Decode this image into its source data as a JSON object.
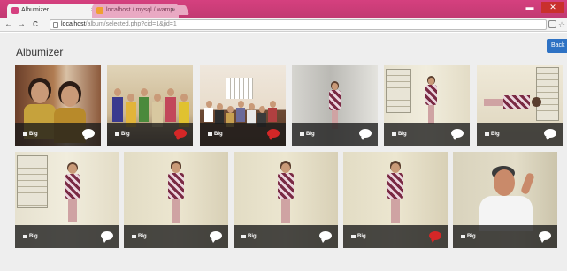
{
  "browser": {
    "tabs": [
      {
        "label": "Albumizer",
        "active": true,
        "favicon_color": "#d5407f"
      },
      {
        "label": "localhost / mysql / wampe",
        "active": false,
        "favicon_color": "#f0a030"
      }
    ],
    "close_glyph": "×",
    "url_host": "localhost",
    "url_path": "/album/selected.php?cid=1&jid=1",
    "nav": {
      "back": "←",
      "forward": "→",
      "reload": "C"
    },
    "window": {
      "minimize": "▬",
      "close": "✕"
    },
    "toolbar_icons": [
      "share-icon",
      "star-icon",
      "menu-icon"
    ]
  },
  "page": {
    "title": "Albumizer",
    "back_button": "Back"
  },
  "gallery": {
    "rows": [
      [
        {
          "label": "Big",
          "comment": "white",
          "scene": "portrait-two"
        },
        {
          "label": "Big",
          "comment": "red",
          "scene": "group-sofa"
        },
        {
          "label": "Big",
          "comment": "red",
          "scene": "group-room"
        },
        {
          "label": "Big",
          "comment": "white",
          "scene": "standing-corner"
        },
        {
          "label": "Big",
          "comment": "white",
          "scene": "standing-shelf"
        },
        {
          "label": "Big",
          "comment": "white",
          "scene": "rotated"
        }
      ],
      [
        {
          "label": "Big",
          "comment": "white",
          "scene": "standing-shelf"
        },
        {
          "label": "Big",
          "comment": "white",
          "scene": "standing-wall"
        },
        {
          "label": "Big",
          "comment": "white",
          "scene": "standing-wall"
        },
        {
          "label": "Big",
          "comment": "red",
          "scene": "standing-wall"
        },
        {
          "label": "Big",
          "comment": "white",
          "scene": "man-pointing"
        }
      ]
    ]
  }
}
